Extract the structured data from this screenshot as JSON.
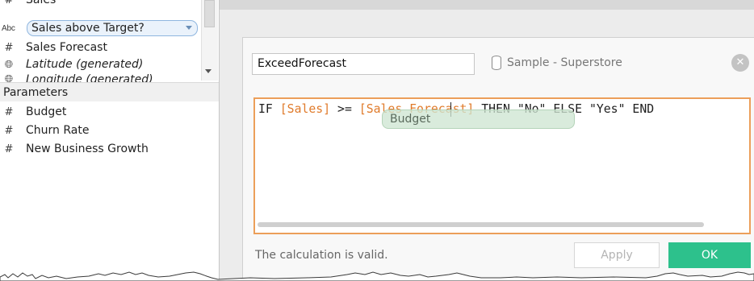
{
  "fields": {
    "items": [
      {
        "icon": "number-icon",
        "label": "Sales"
      },
      {
        "icon": "string-icon",
        "icon_text": "Abc",
        "label": "Sales above Target?",
        "selected": true
      },
      {
        "icon": "number-icon",
        "label": "Sales Forecast"
      },
      {
        "icon": "globe-icon",
        "label": "Latitude (generated)",
        "italic": true
      },
      {
        "icon": "globe-icon",
        "label": "Longitude (generated)",
        "italic": true
      }
    ]
  },
  "parameters": {
    "header": "Parameters",
    "items": [
      {
        "icon": "number-icon",
        "label": "Budget"
      },
      {
        "icon": "number-icon",
        "label": "Churn Rate"
      },
      {
        "icon": "number-icon",
        "label": "New Business Growth"
      }
    ]
  },
  "dialog": {
    "calc_name": "ExceedForecast",
    "datasource": "Sample - Superstore",
    "formula": {
      "if": "IF",
      "ref1": "[Sales]",
      "op": ">=",
      "ref2": "[Sales Forecast]",
      "then": "THEN",
      "str1": "\"No\"",
      "else": "ELSE",
      "str2": "\"Yes\"",
      "end": "END"
    },
    "autocomplete_suggestion": "Budget",
    "status": "The calculation is valid.",
    "apply_label": "Apply",
    "ok_label": "OK"
  },
  "colors": {
    "accent_orange": "#ec9f5a",
    "field_ref": "#e07b2b",
    "ok_green": "#2dc18c",
    "selection_blue": "#eaf2fb"
  }
}
